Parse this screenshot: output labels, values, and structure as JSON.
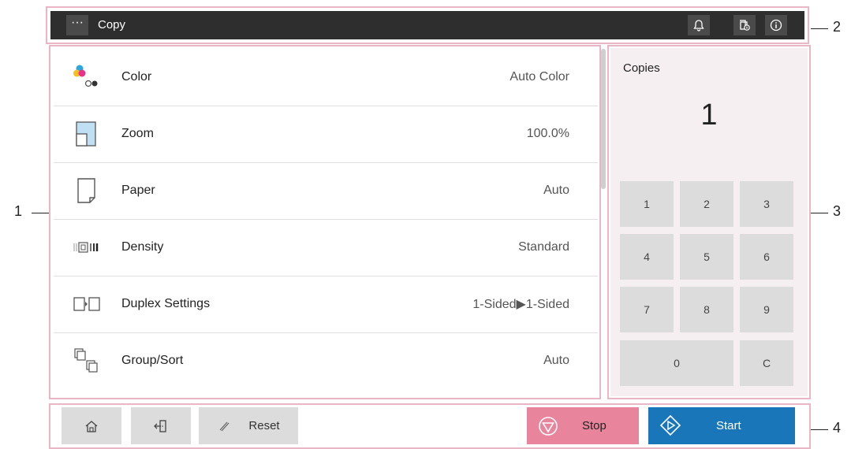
{
  "topbar": {
    "more_label": "···",
    "title": "Copy",
    "icons": [
      "bell-icon",
      "device-info-icon",
      "info-icon"
    ]
  },
  "settings": [
    {
      "label": "Color",
      "value": "Auto  Color",
      "icon": "color-icon"
    },
    {
      "label": "Zoom",
      "value": "100.0%",
      "icon": "zoom-icon"
    },
    {
      "label": "Paper",
      "value": "Auto",
      "icon": "paper-icon"
    },
    {
      "label": "Density",
      "value": "Standard",
      "icon": "density-icon"
    },
    {
      "label": "Duplex  Settings",
      "value": "1-Sided▶1-Sided",
      "icon": "duplex-icon"
    },
    {
      "label": "Group/Sort",
      "value": "Auto",
      "icon": "group-sort-icon"
    }
  ],
  "copies": {
    "label": "Copies",
    "count": "1",
    "keys": [
      "1",
      "2",
      "3",
      "4",
      "5",
      "6",
      "7",
      "8",
      "9",
      "0",
      "C"
    ]
  },
  "bottom": {
    "reset_label": "Reset",
    "stop_label": "Stop",
    "start_label": "Start"
  },
  "callouts": [
    "1",
    "2",
    "3",
    "4"
  ],
  "colors": {
    "accent_frame": "#e8b6c5",
    "stop": "#e8859d",
    "start": "#1976b8",
    "topbar": "#2e2e2e"
  }
}
